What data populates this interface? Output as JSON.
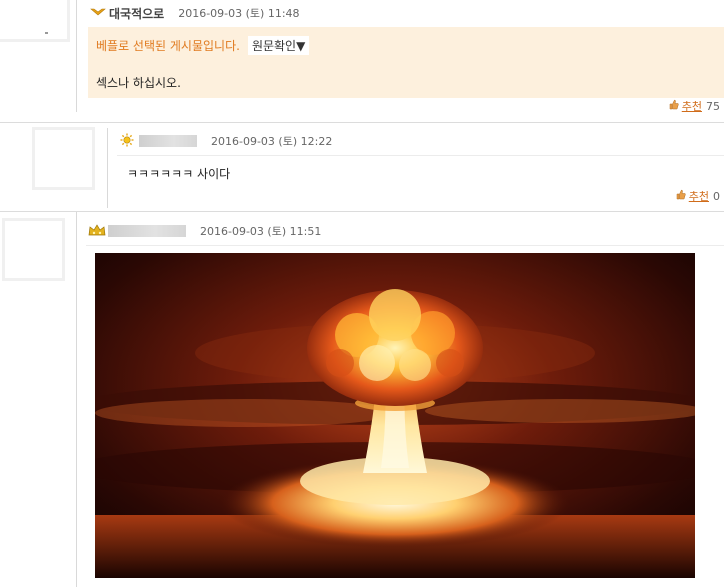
{
  "comments": [
    {
      "nickname": "대국적으로",
      "date": "2016-09-03 (토) 11:48",
      "best_notice": "베플로 선택된 게시물입니다.",
      "view_original": "원문확인▼",
      "body": "섹스나 하십시오.",
      "recommend_label": "추천",
      "recommend_count": "75",
      "level_icon": "gold-badge-icon"
    },
    {
      "nickname": "",
      "date": "2016-09-03 (토) 12:22",
      "body": "ㅋㅋㅋㅋㅋㅋ 사이다",
      "recommend_label": "추천",
      "recommend_count": "0",
      "level_icon": "sun-badge-icon"
    },
    {
      "nickname": "",
      "date": "2016-09-03 (토) 11:51",
      "attachment": "nuclear-explosion-image",
      "level_icon": "gold-crown-badge-icon"
    }
  ],
  "colors": {
    "best_bg": "#fdf0dd",
    "best_text": "#e07a1f",
    "recommend_link": "#d06c1a"
  }
}
